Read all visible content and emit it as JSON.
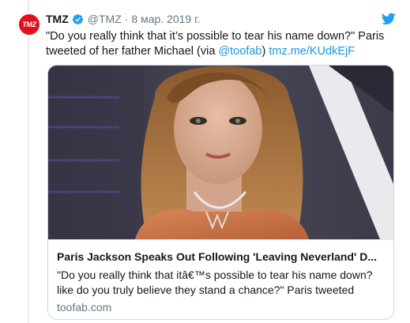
{
  "tweet": {
    "avatar_text": "TMZ",
    "display_name": "TMZ",
    "handle": "@TMZ",
    "separator": "·",
    "date": "8 мар. 2019 г.",
    "text_parts": {
      "quote": "\"Do you really think that it’s possible to tear his name down?\" Paris tweeted of her father Michael (via ",
      "mention": "@toofab",
      "close": ")",
      "url": "tmz.me/KUdkEjF"
    },
    "icons": {
      "verified": "verified-badge-icon",
      "platform": "twitter-bird-icon"
    },
    "colors": {
      "link": "#1b95e0",
      "verified": "#1da1f2",
      "brand_red": "#e0111f"
    }
  },
  "card": {
    "title": "Paris Jackson Speaks Out Following 'Leaving Neverland' D...",
    "description": "\"Do you really think that itâ€™s possible to tear his name down? like do you truly believe they stand a chance?\" Paris tweeted",
    "domain": "toofab.com",
    "image_alt": "photo-of-woman-with-wavy-hair-at-event"
  }
}
